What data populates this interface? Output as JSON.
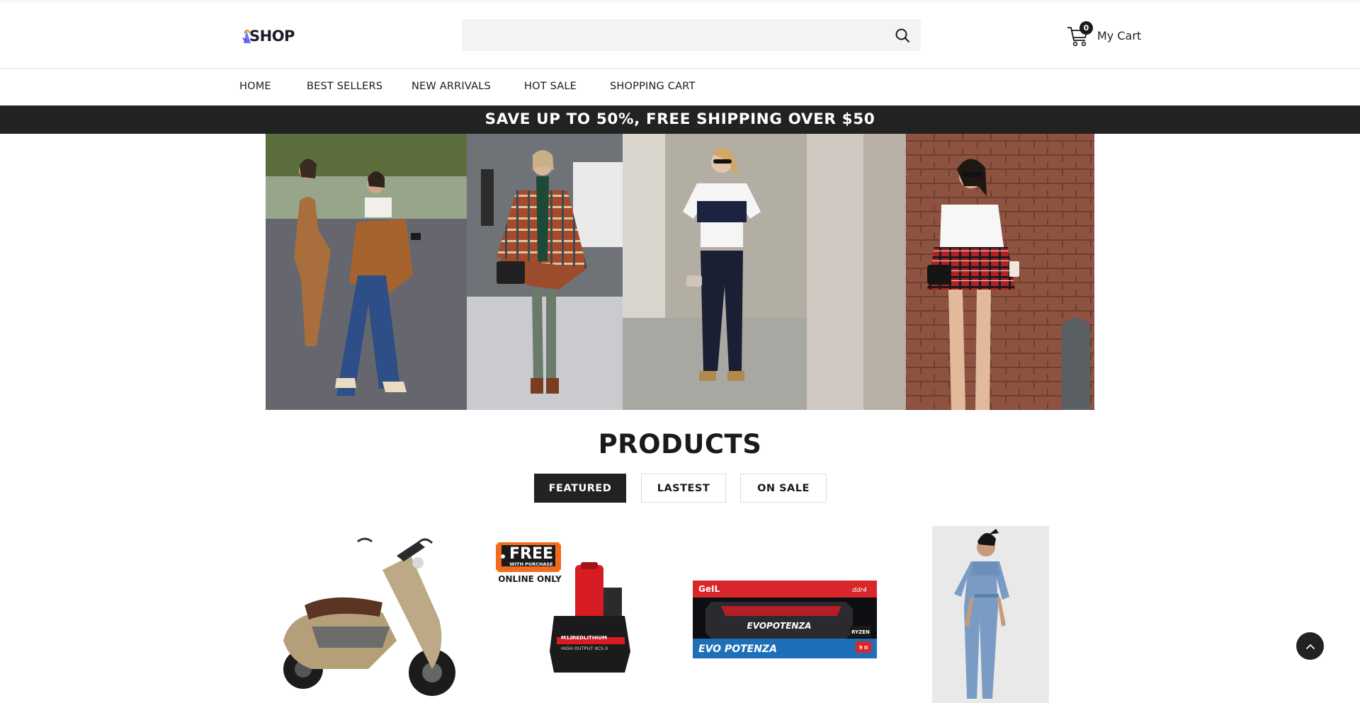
{
  "header": {
    "logo_text": "SHOP",
    "search": {
      "placeholder": "",
      "value": ""
    },
    "cart": {
      "count": "0",
      "label": "My Cart"
    }
  },
  "nav": {
    "items": [
      {
        "label": "HOME"
      },
      {
        "label": "BEST SELLERS"
      },
      {
        "label": "NEW ARRIVALS"
      },
      {
        "label": "HOT SALE"
      },
      {
        "label": "SHOPPING CART"
      }
    ]
  },
  "promo": {
    "text": "SAVE UP TO 50%, FREE SHIPPING OVER $50"
  },
  "products": {
    "title": "PRODUCTS",
    "tabs": [
      {
        "label": "FEATURED",
        "active": true
      },
      {
        "label": "LASTEST",
        "active": false
      },
      {
        "label": "ON SALE",
        "active": false
      }
    ],
    "items": [
      {
        "image": "scooter"
      },
      {
        "image": "battery",
        "badge_main": "FREE",
        "badge_sub": "WITH PURCHASE",
        "badge_note": "ONLINE ONLY",
        "product_text_1": "M12",
        "product_text_2": "REDLITHIUM",
        "product_text_3": "HIGH OUTPUT XC5.0"
      },
      {
        "image": "ram",
        "brand": "GeIL",
        "model": "EVO POTENZA",
        "model_top": "EVOPOTENZA",
        "tag": "ddr4",
        "badge_left": "RYZEN",
        "badge_right": "9 II"
      },
      {
        "image": "jumpsuit"
      }
    ]
  },
  "colors": {
    "promo_bg": "#222222",
    "tab_active_bg": "#222222",
    "ram_red": "#d8262b",
    "ram_blue": "#1d6fb8",
    "battery_red": "#d81c24"
  }
}
